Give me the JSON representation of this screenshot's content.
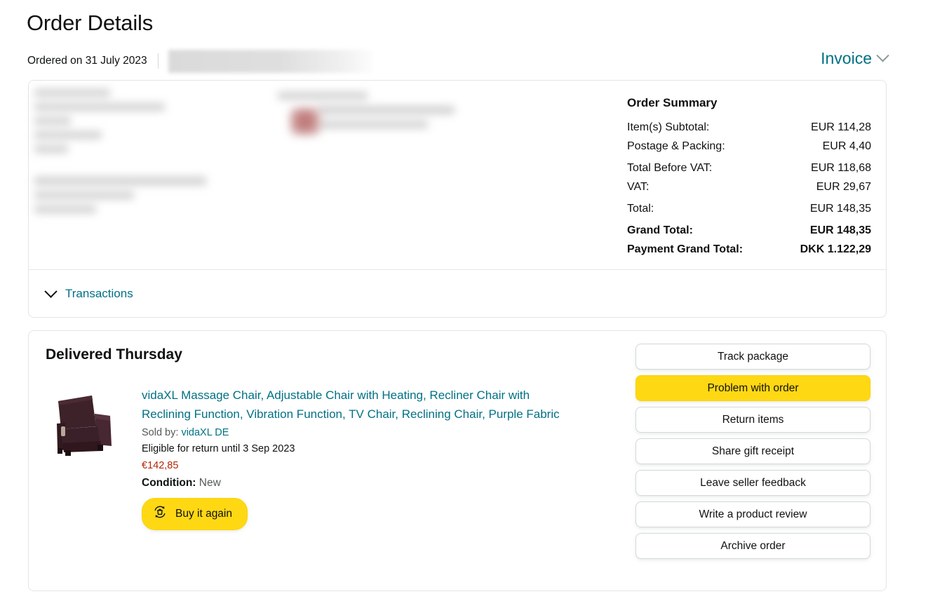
{
  "header": {
    "title": "Order Details",
    "ordered_on": "Ordered on 31 July 2023",
    "invoice_label": "Invoice",
    "invoice_icon": "chevron-down-icon"
  },
  "order_summary": {
    "title": "Order Summary",
    "rows": [
      {
        "label": "Item(s) Subtotal:",
        "value": "EUR 114,28",
        "bold": false
      },
      {
        "label": "Postage & Packing:",
        "value": "EUR 4,40",
        "bold": false
      },
      {
        "label": "Total Before VAT:",
        "value": "EUR 118,68",
        "bold": false
      },
      {
        "label": "VAT:",
        "value": "EUR 29,67",
        "bold": false
      },
      {
        "label": "Total:",
        "value": "EUR 148,35",
        "bold": false
      },
      {
        "label": "Grand Total:",
        "value": "EUR 148,35",
        "bold": true
      },
      {
        "label": "Payment Grand Total:",
        "value": "DKK 1.122,29",
        "bold": true
      }
    ]
  },
  "transactions": {
    "label": "Transactions",
    "icon": "chevron-down-icon"
  },
  "shipment": {
    "status_title": "Delivered Thursday",
    "product": {
      "thumbnail_icon": "recliner-chair-image",
      "title": "vidaXL Massage Chair, Adjustable Chair with Heating, Recliner Chair with Reclining Function, Vibration Function, TV Chair, Reclining Chair, Purple Fabric",
      "sold_by_label": "Sold by:",
      "sold_by_seller": "vidaXL DE",
      "return_eligibility": "Eligible for return until 3 Sep 2023",
      "price": "€142,85",
      "condition_label": "Condition:",
      "condition_value": "New",
      "buy_again_label": "Buy it again",
      "buy_again_icon": "buy-again-icon"
    },
    "actions": [
      {
        "label": "Track package",
        "primary": false
      },
      {
        "label": "Problem with order",
        "primary": true
      },
      {
        "label": "Return items",
        "primary": false
      },
      {
        "label": "Share gift receipt",
        "primary": false
      },
      {
        "label": "Leave seller feedback",
        "primary": false
      },
      {
        "label": "Write a product review",
        "primary": false
      },
      {
        "label": "Archive order",
        "primary": false
      }
    ]
  },
  "colors": {
    "link_teal": "#007185",
    "amazon_yellow": "#ffd814",
    "price_red": "#b12704",
    "text_primary": "#0f1111",
    "text_secondary": "#565959",
    "border": "#e3e6e6"
  }
}
